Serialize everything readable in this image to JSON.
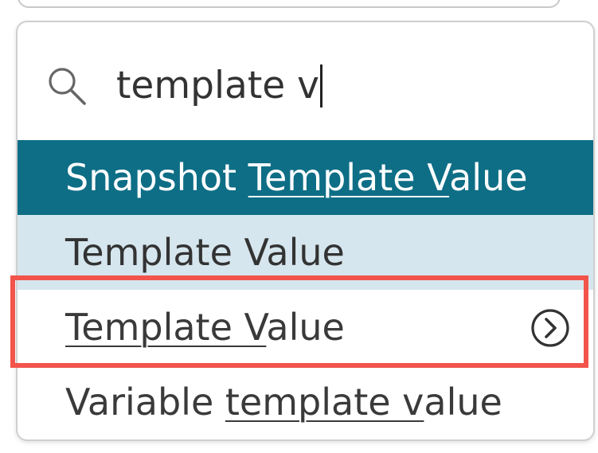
{
  "search": {
    "value": "template v",
    "icon": "search-icon"
  },
  "options": [
    {
      "pre": "Snapshot ",
      "match": "Template V",
      "post": "alue",
      "state": "active"
    },
    {
      "pre": "Template Value",
      "match": "",
      "post": "",
      "state": "hover"
    },
    {
      "pre": "",
      "match": "Template V",
      "post": "alue",
      "state": "normal",
      "icon": "chevron-right-circle-icon"
    },
    {
      "pre": "Variable ",
      "match": "template v",
      "post": "alue",
      "state": "normal"
    }
  ],
  "colors": {
    "active_bg": "#0e6e86",
    "hover_bg": "#d6e6ee",
    "highlight_border": "#f2544b"
  }
}
